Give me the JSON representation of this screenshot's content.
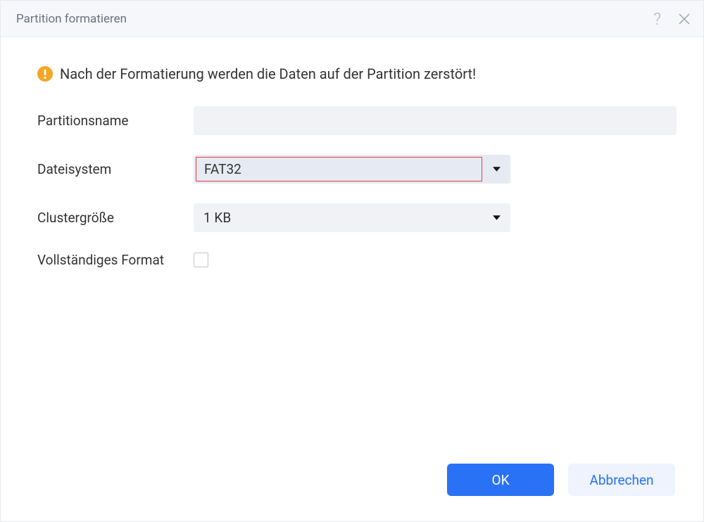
{
  "titlebar": {
    "title": "Partition formatieren"
  },
  "warning": {
    "text": "Nach der Formatierung werden die Daten auf der Partition zerstört!"
  },
  "form": {
    "partition_name": {
      "label": "Partitionsname",
      "value": ""
    },
    "filesystem": {
      "label": "Dateisystem",
      "value": "FAT32"
    },
    "cluster_size": {
      "label": "Clustergröße",
      "value": "1 KB"
    },
    "full_format": {
      "label": "Vollständiges Format",
      "checked": false
    }
  },
  "buttons": {
    "ok": "OK",
    "cancel": "Abbrechen"
  }
}
